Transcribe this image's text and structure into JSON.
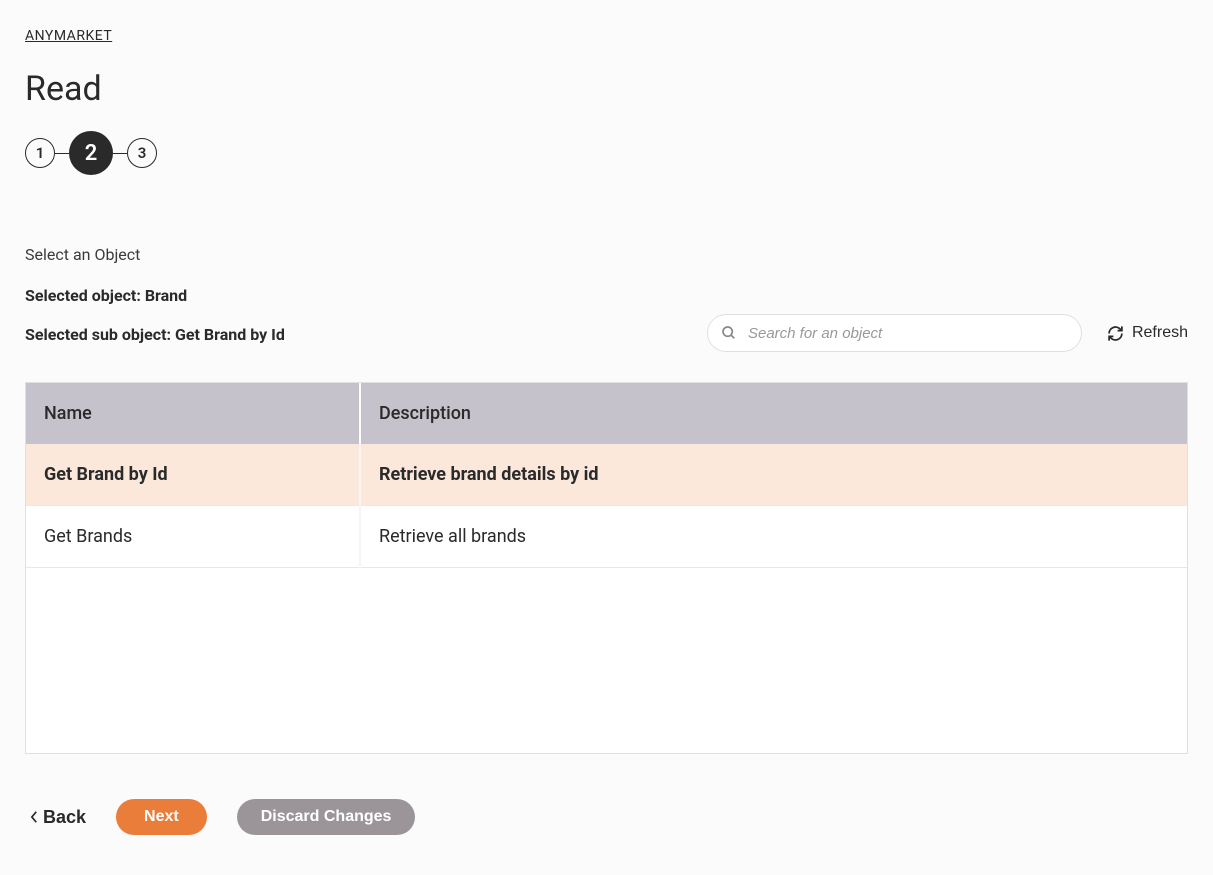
{
  "breadcrumb": {
    "link_text": "ANYMARKET"
  },
  "page": {
    "title": "Read"
  },
  "stepper": {
    "steps": [
      "1",
      "2",
      "3"
    ],
    "active_index": 1
  },
  "section": {
    "label": "Select an Object",
    "selected_object_label": "Selected object: Brand",
    "selected_sub_object_label": "Selected sub object: Get Brand by Id"
  },
  "search": {
    "placeholder": "Search for an object",
    "value": ""
  },
  "refresh": {
    "label": "Refresh"
  },
  "table": {
    "headers": {
      "name": "Name",
      "description": "Description"
    },
    "rows": [
      {
        "name": "Get Brand by Id",
        "description": "Retrieve brand details by id",
        "selected": true
      },
      {
        "name": "Get Brands",
        "description": "Retrieve all brands",
        "selected": false
      }
    ]
  },
  "actions": {
    "back": "Back",
    "next": "Next",
    "discard": "Discard Changes"
  }
}
